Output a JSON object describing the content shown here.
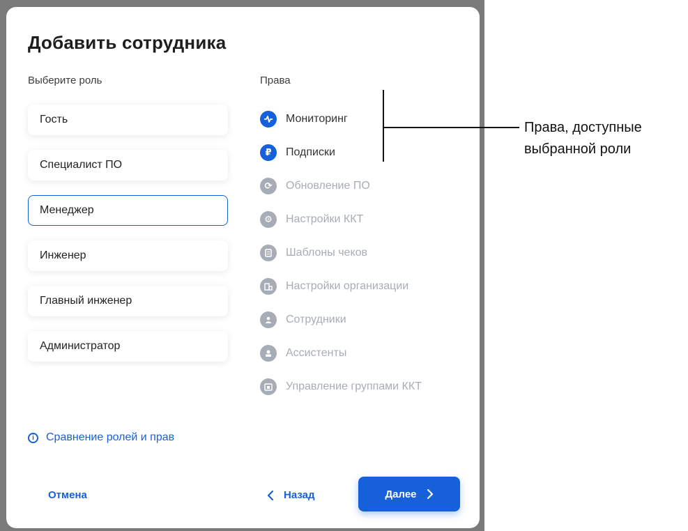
{
  "dialog": {
    "title": "Добавить сотрудника",
    "roles_label": "Выберите роль",
    "rights_label": "Права",
    "roles": [
      {
        "label": "Гость",
        "selected": false
      },
      {
        "label": "Специалист ПО",
        "selected": false
      },
      {
        "label": "Менеджер",
        "selected": true
      },
      {
        "label": "Инженер",
        "selected": false
      },
      {
        "label": "Главный инженер",
        "selected": false
      },
      {
        "label": "Администратор",
        "selected": false
      }
    ],
    "rights": [
      {
        "label": "Мониторинг",
        "enabled": true,
        "icon": "pulse-icon"
      },
      {
        "label": "Подписки",
        "enabled": true,
        "icon": "ruble-icon"
      },
      {
        "label": "Обновление ПО",
        "enabled": false,
        "icon": "refresh-icon"
      },
      {
        "label": "Настройки ККТ",
        "enabled": false,
        "icon": "gear-icon"
      },
      {
        "label": "Шаблоны чеков",
        "enabled": false,
        "icon": "receipt-icon"
      },
      {
        "label": "Настройки организации",
        "enabled": false,
        "icon": "building-icon"
      },
      {
        "label": "Сотрудники",
        "enabled": false,
        "icon": "people-icon"
      },
      {
        "label": "Ассистенты",
        "enabled": false,
        "icon": "assistant-icon"
      },
      {
        "label": "Управление группами ККТ",
        "enabled": false,
        "icon": "group-icon"
      }
    ],
    "compare_link": "Сравнение ролей и прав",
    "cancel_label": "Отмена",
    "back_label": "Назад",
    "next_label": "Далее"
  },
  "annotation": {
    "line1": "Права, доступные",
    "line2": "выбранной роли"
  },
  "colors": {
    "accent": "#1660d9",
    "disabled": "#a8adb5",
    "backdrop": "#7a7a7a"
  }
}
